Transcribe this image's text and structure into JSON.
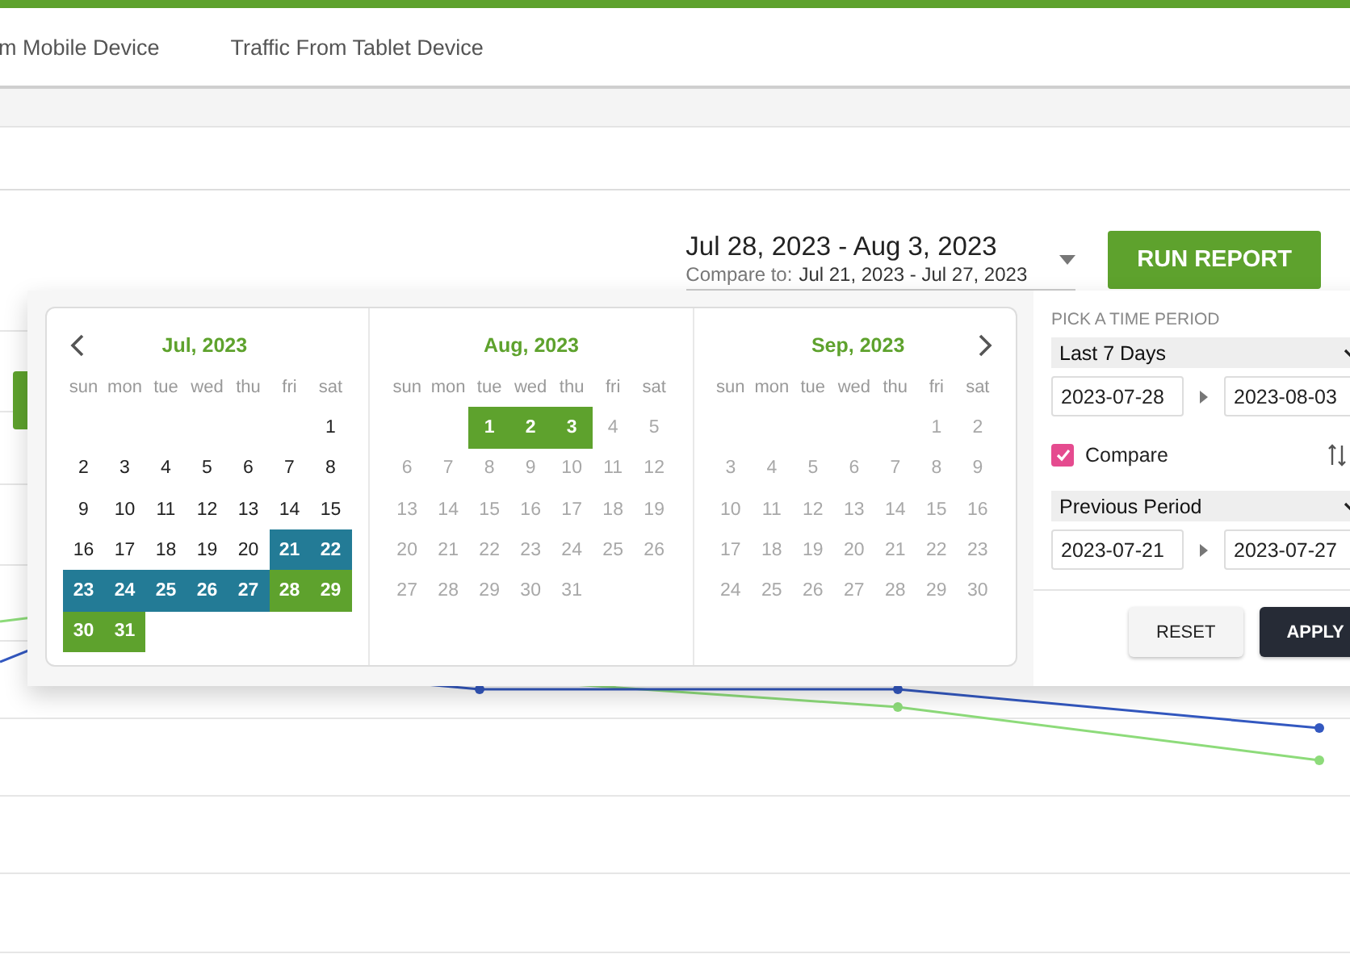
{
  "tabs": [
    {
      "label": "m Mobile Device",
      "selected": false
    },
    {
      "label": "Traffic From Tablet Device",
      "selected": false
    }
  ],
  "date_picker": {
    "range": "Jul 28, 2023 - Aug 3, 2023",
    "compare_label": "Compare to:",
    "compare_range": "Jul 21, 2023 - Jul 27, 2023",
    "expanded": true
  },
  "run_button": "RUN REPORT",
  "calendar": {
    "months": [
      {
        "title": "Jul, 2023",
        "weekdays": [
          "sun",
          "mon",
          "tue",
          "wed",
          "thu",
          "fri",
          "sat"
        ],
        "weeks": [
          [
            {
              "label": "1",
              "kind": "normal"
            }
          ],
          [
            {
              "label": "2",
              "kind": "normal"
            },
            {
              "label": "3",
              "kind": "normal"
            },
            {
              "label": "4",
              "kind": "normal"
            },
            {
              "label": "5",
              "kind": "normal"
            },
            {
              "label": "6",
              "kind": "normal"
            },
            {
              "label": "7",
              "kind": "normal"
            },
            {
              "label": "8",
              "kind": "normal"
            }
          ],
          [
            {
              "label": "9",
              "kind": "normal"
            },
            {
              "label": "10",
              "kind": "normal"
            },
            {
              "label": "11",
              "kind": "normal"
            },
            {
              "label": "12",
              "kind": "normal"
            },
            {
              "label": "13",
              "kind": "normal"
            },
            {
              "label": "14",
              "kind": "normal"
            },
            {
              "label": "15",
              "kind": "normal"
            }
          ],
          [
            {
              "label": "16",
              "kind": "normal"
            },
            {
              "label": "17",
              "kind": "normal"
            },
            {
              "label": "18",
              "kind": "normal"
            },
            {
              "label": "19",
              "kind": "normal"
            },
            {
              "label": "20",
              "kind": "normal"
            },
            {
              "label": "21",
              "kind": "compare"
            },
            {
              "label": "22",
              "kind": "compare"
            }
          ],
          [
            {
              "label": "23",
              "kind": "compare"
            },
            {
              "label": "24",
              "kind": "compare"
            },
            {
              "label": "25",
              "kind": "compare"
            },
            {
              "label": "26",
              "kind": "compare"
            },
            {
              "label": "27",
              "kind": "compare"
            },
            {
              "label": "28",
              "kind": "range"
            },
            {
              "label": "29",
              "kind": "range"
            }
          ],
          [
            {
              "label": "30",
              "kind": "range"
            },
            {
              "label": "31",
              "kind": "range"
            }
          ]
        ]
      },
      {
        "title": "Aug, 2023",
        "weekdays": [
          "sun",
          "mon",
          "tue",
          "wed",
          "thu",
          "fri",
          "sat"
        ],
        "weeks": [
          [
            {
              "label": "1",
              "kind": "range"
            },
            {
              "label": "2",
              "kind": "range"
            },
            {
              "label": "3",
              "kind": "range"
            },
            {
              "label": "4",
              "kind": "disabled"
            },
            {
              "label": "5",
              "kind": "disabled"
            }
          ],
          [
            {
              "label": "6",
              "kind": "disabled"
            },
            {
              "label": "7",
              "kind": "disabled"
            },
            {
              "label": "8",
              "kind": "disabled"
            },
            {
              "label": "9",
              "kind": "disabled"
            },
            {
              "label": "10",
              "kind": "disabled"
            },
            {
              "label": "11",
              "kind": "disabled"
            },
            {
              "label": "12",
              "kind": "disabled"
            }
          ],
          [
            {
              "label": "13",
              "kind": "disabled"
            },
            {
              "label": "14",
              "kind": "disabled"
            },
            {
              "label": "15",
              "kind": "disabled"
            },
            {
              "label": "16",
              "kind": "disabled"
            },
            {
              "label": "17",
              "kind": "disabled"
            },
            {
              "label": "18",
              "kind": "disabled"
            },
            {
              "label": "19",
              "kind": "disabled"
            }
          ],
          [
            {
              "label": "20",
              "kind": "disabled"
            },
            {
              "label": "21",
              "kind": "disabled"
            },
            {
              "label": "22",
              "kind": "disabled"
            },
            {
              "label": "23",
              "kind": "disabled"
            },
            {
              "label": "24",
              "kind": "disabled"
            },
            {
              "label": "25",
              "kind": "disabled"
            },
            {
              "label": "26",
              "kind": "disabled"
            }
          ],
          [
            {
              "label": "27",
              "kind": "disabled"
            },
            {
              "label": "28",
              "kind": "disabled"
            },
            {
              "label": "29",
              "kind": "disabled"
            },
            {
              "label": "30",
              "kind": "disabled"
            },
            {
              "label": "31",
              "kind": "disabled"
            }
          ]
        ]
      },
      {
        "title": "Sep, 2023",
        "weekdays": [
          "sun",
          "mon",
          "tue",
          "wed",
          "thu",
          "fri",
          "sat"
        ],
        "weeks": [
          [
            {
              "label": "1",
              "kind": "disabled"
            },
            {
              "label": "2",
              "kind": "disabled"
            }
          ],
          [
            {
              "label": "3",
              "kind": "disabled"
            },
            {
              "label": "4",
              "kind": "disabled"
            },
            {
              "label": "5",
              "kind": "disabled"
            },
            {
              "label": "6",
              "kind": "disabled"
            },
            {
              "label": "7",
              "kind": "disabled"
            },
            {
              "label": "8",
              "kind": "disabled"
            },
            {
              "label": "9",
              "kind": "disabled"
            }
          ],
          [
            {
              "label": "10",
              "kind": "disabled"
            },
            {
              "label": "11",
              "kind": "disabled"
            },
            {
              "label": "12",
              "kind": "disabled"
            },
            {
              "label": "13",
              "kind": "disabled"
            },
            {
              "label": "14",
              "kind": "disabled"
            },
            {
              "label": "15",
              "kind": "disabled"
            },
            {
              "label": "16",
              "kind": "disabled"
            }
          ],
          [
            {
              "label": "17",
              "kind": "disabled"
            },
            {
              "label": "18",
              "kind": "disabled"
            },
            {
              "label": "19",
              "kind": "disabled"
            },
            {
              "label": "20",
              "kind": "disabled"
            },
            {
              "label": "21",
              "kind": "disabled"
            },
            {
              "label": "22",
              "kind": "disabled"
            },
            {
              "label": "23",
              "kind": "disabled"
            }
          ],
          [
            {
              "label": "24",
              "kind": "disabled"
            },
            {
              "label": "25",
              "kind": "disabled"
            },
            {
              "label": "26",
              "kind": "disabled"
            },
            {
              "label": "27",
              "kind": "disabled"
            },
            {
              "label": "28",
              "kind": "disabled"
            },
            {
              "label": "29",
              "kind": "disabled"
            },
            {
              "label": "30",
              "kind": "disabled"
            }
          ]
        ]
      }
    ]
  },
  "period_panel": {
    "heading": "PICK A TIME PERIOD",
    "period": "Last 7 Days",
    "start": "2023-07-28",
    "end": "2023-08-03",
    "compare": {
      "label": "Compare",
      "checked": true
    },
    "compare_period": "Previous Period",
    "compare_start": "2023-07-21",
    "compare_end": "2023-07-27",
    "buttons": [
      {
        "label": "RESET",
        "kind": "secondary"
      },
      {
        "label": "APPLY",
        "kind": "primary"
      }
    ]
  }
}
